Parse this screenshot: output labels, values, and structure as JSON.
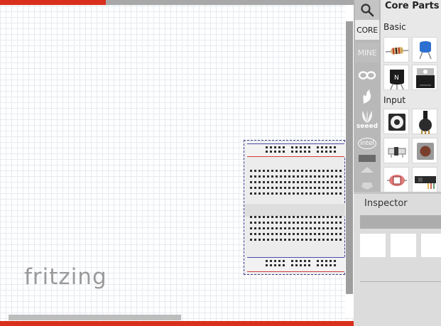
{
  "canvas": {
    "logo_text": "fritzing",
    "top_progress": 0.3,
    "horizontal_scroll_fraction": 0.49
  },
  "tabs": [
    {
      "id": "search",
      "icon": "magnifier-icon"
    },
    {
      "id": "core",
      "label": "CORE",
      "active": true
    },
    {
      "id": "mine",
      "label": "MINE"
    },
    {
      "id": "arduino",
      "icon": "arduino-icon"
    },
    {
      "id": "sparkfun",
      "icon": "sparkfun-flame-icon"
    },
    {
      "id": "seeed",
      "label": "seeed",
      "icon": "seeed-leaf-icon"
    },
    {
      "id": "intel",
      "label": "intel",
      "icon": "intel-icon"
    },
    {
      "id": "more",
      "icon": "bin-more-icon"
    },
    {
      "id": "scroll-up",
      "icon": "triangle-up-icon"
    },
    {
      "id": "scroll-down",
      "icon": "triangle-down-icon"
    }
  ],
  "parts_bin": {
    "title": "Core Parts",
    "sections": [
      {
        "label": "Basic",
        "parts": [
          "resistor-icon",
          "ceramic-capacitor-icon",
          "npn-transistor-icon",
          "mosfet-icon"
        ]
      },
      {
        "label": "Input",
        "parts": [
          "potentiometer-icon",
          "rotary-potentiometer-icon",
          "switch-icon",
          "pushbutton-icon",
          "light-sensor-icon",
          "sensor-module-icon"
        ]
      }
    ]
  },
  "inspector": {
    "title": "Inspector"
  },
  "colors": {
    "accent_red": "#d8301c",
    "canvas_bg": "#ffffff",
    "grid": "#e6ebf0",
    "breadboard_outline": "#3a3a90"
  }
}
